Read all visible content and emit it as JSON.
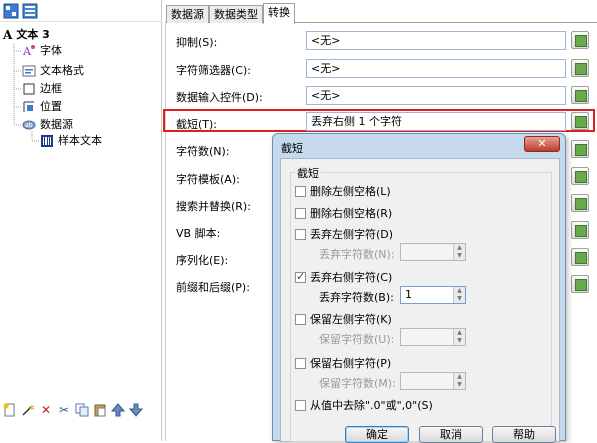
{
  "tree": {
    "root": "文本 3",
    "items": [
      "字体",
      "文本格式",
      "边框",
      "位置",
      "数据源"
    ],
    "child": "样本文本"
  },
  "tabs": [
    "数据源",
    "数据类型",
    "转换"
  ],
  "properties": [
    {
      "label": "抑制(S):",
      "value": "<无>"
    },
    {
      "label": "字符筛选器(C):",
      "value": "<无>"
    },
    {
      "label": "数据输入控件(D):",
      "value": "<无>"
    },
    {
      "label": "截短(T):",
      "value": "丢弃右侧 1 个字符"
    },
    {
      "label": "字符数(N):",
      "value": ""
    },
    {
      "label": "字符模板(A):",
      "value": ""
    },
    {
      "label": "搜索并替换(R):",
      "value": ""
    },
    {
      "label": "VB 脚本:",
      "value": ""
    },
    {
      "label": "序列化(E):",
      "value": ""
    },
    {
      "label": "前缀和后缀(P):",
      "value": ""
    }
  ],
  "dialog": {
    "title": "截短",
    "close": "✕",
    "group": "截短",
    "options": [
      {
        "label": "删除左侧空格(L)",
        "checked": false
      },
      {
        "label": "删除右侧空格(R)",
        "checked": false
      },
      {
        "label": "丢弃左侧字符(D)",
        "checked": false
      },
      {
        "label": "丢弃右侧字符(C)",
        "checked": true
      },
      {
        "label": "保留左侧字符(K)",
        "checked": false
      },
      {
        "label": "保留右侧字符(P)",
        "checked": false
      },
      {
        "label": "从值中去除\".0\"或\",0\"(S)",
        "checked": false
      }
    ],
    "count_labels": [
      "丢弃字符数(N):",
      "丢弃字符数(B):",
      "保留字符数(U):",
      "保留字符数(M):"
    ],
    "count_values": [
      "",
      "1",
      "",
      ""
    ],
    "buttons": {
      "ok": "确定",
      "cancel": "取消",
      "help": "帮助"
    }
  },
  "colors": {
    "highlight": "#e02020",
    "dialog_frame": "#c5d9ef"
  }
}
